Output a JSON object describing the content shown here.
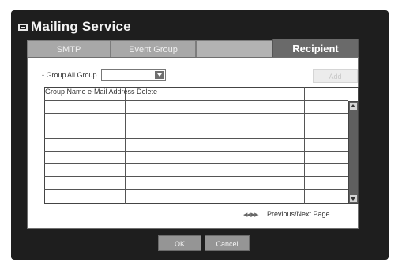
{
  "window": {
    "title": "Mailing Service"
  },
  "tabs": [
    {
      "label": "SMTP",
      "active": false
    },
    {
      "label": "Event Group",
      "active": false
    },
    {
      "label": "Recipient",
      "active": true
    }
  ],
  "filter": {
    "label": "- Group",
    "selected": "All Group"
  },
  "toolbar": {
    "add_label": "Add"
  },
  "table": {
    "header_text": "Group Name e-Mail Address Delete",
    "rows": []
  },
  "pager": {
    "label": "Previous/Next Page"
  },
  "footer": {
    "ok_label": "OK",
    "cancel_label": "Cancel"
  }
}
